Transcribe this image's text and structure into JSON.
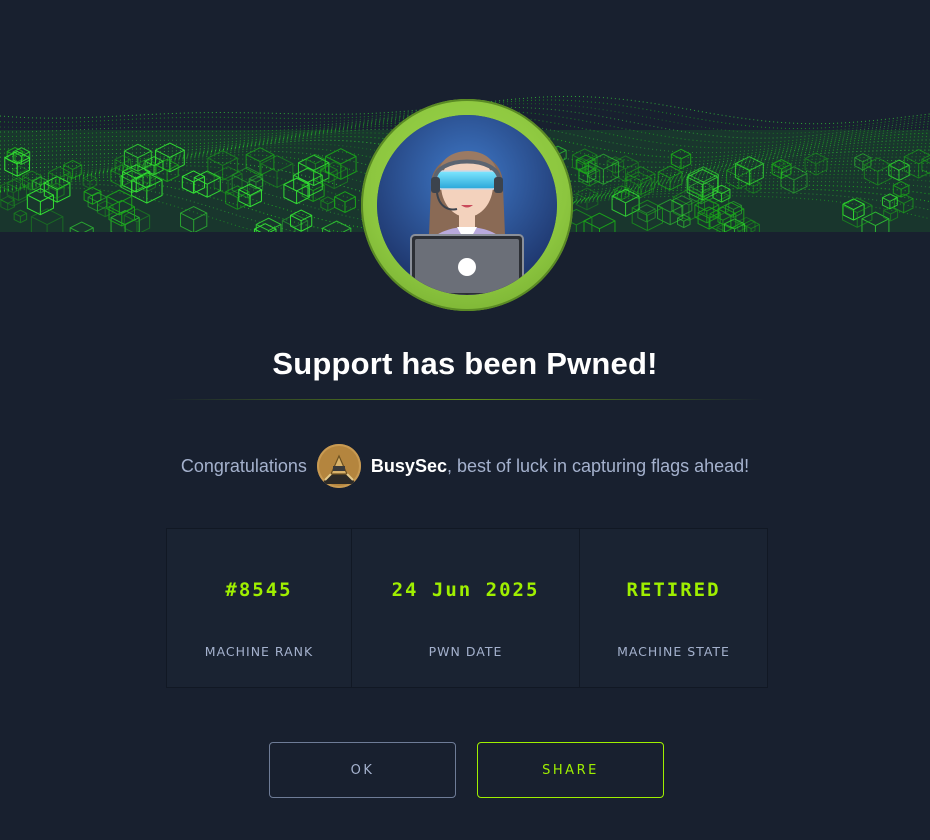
{
  "dialog": {
    "title": "Support has been Pwned!",
    "congrats_prefix": "Congratulations",
    "username": "BusySec",
    "congrats_suffix": ", best of luck in capturing flags ahead!"
  },
  "stats": [
    {
      "value": "#8545",
      "label": "MACHINE RANK"
    },
    {
      "value": "24 Jun 2025",
      "label": "PWN DATE"
    },
    {
      "value": "RETIRED",
      "label": "MACHINE STATE"
    }
  ],
  "buttons": {
    "ok_label": "OK",
    "share_label": "SHARE"
  },
  "colors": {
    "background": "#18202f",
    "accent_green": "#9fef00",
    "ring_green": "#8cc63f",
    "text_muted": "#a4b1cd"
  },
  "icons": {
    "machine_avatar": "support-agent-avatar",
    "user_avatar": "busysec-avatar"
  }
}
